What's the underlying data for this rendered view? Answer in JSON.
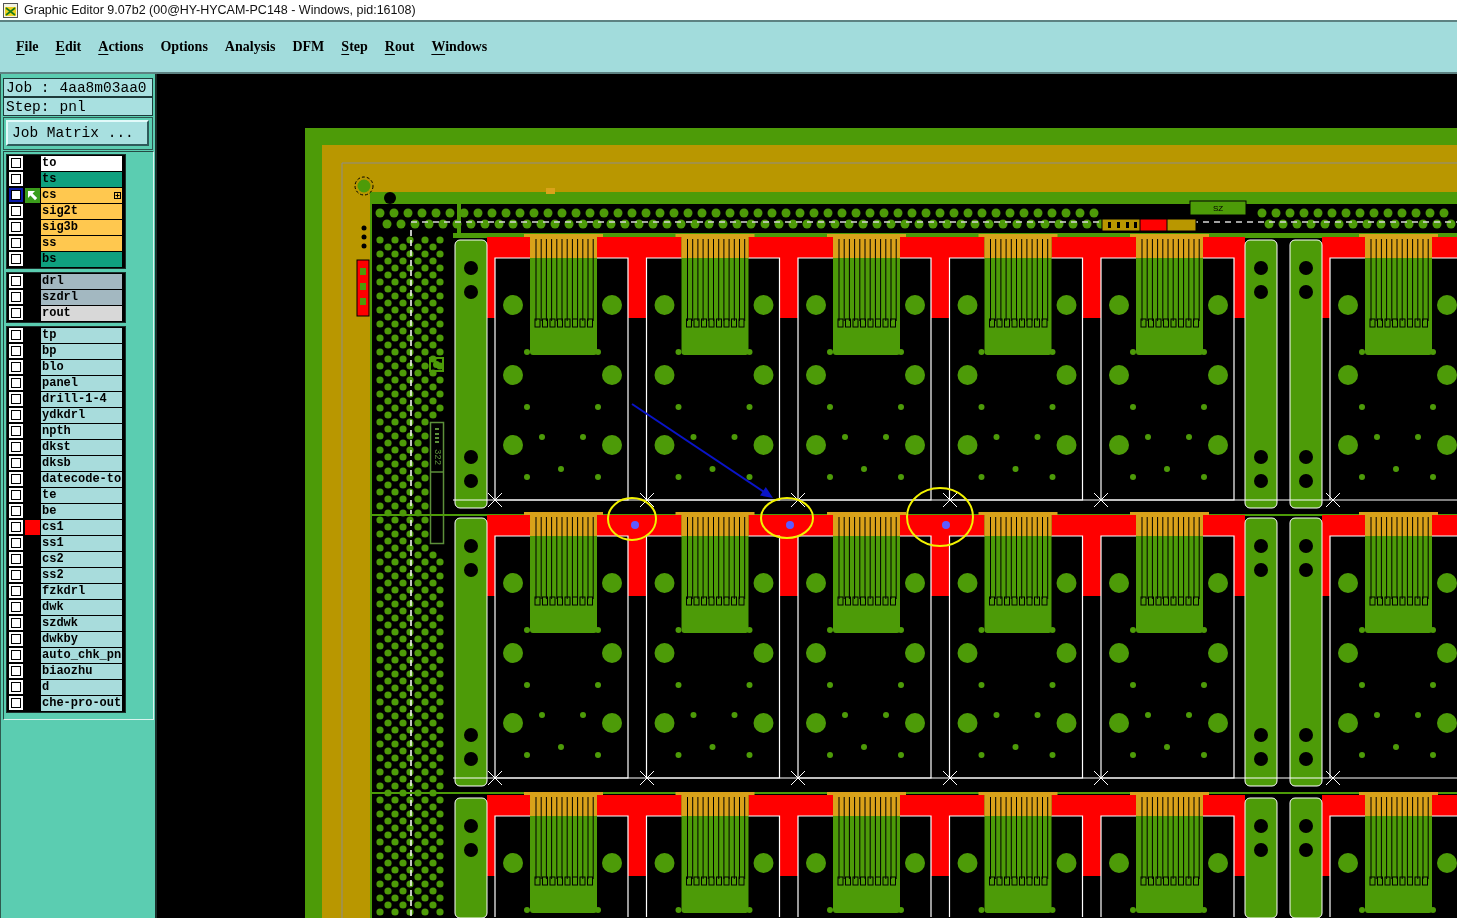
{
  "window": {
    "title": "Graphic Editor 9.07b2 (00@HY-HYCAM-PC148 - Windows, pid:16108)"
  },
  "menu": [
    {
      "label": "File",
      "mnemonic": true
    },
    {
      "label": "Edit",
      "mnemonic": true
    },
    {
      "label": "Actions",
      "mnemonic": true
    },
    {
      "label": "Options",
      "mnemonic": false
    },
    {
      "label": "Analysis",
      "mnemonic": false
    },
    {
      "label": "DFM",
      "mnemonic": false
    },
    {
      "label": "Step",
      "mnemonic": true
    },
    {
      "label": "Rout",
      "mnemonic": true
    },
    {
      "label": "Windows",
      "mnemonic": true
    }
  ],
  "job": {
    "label": "Job :",
    "value": "4aa8m03aa0"
  },
  "step": {
    "label": "Step:",
    "value": "pnl"
  },
  "job_matrix_button": "Job Matrix ...",
  "layer_groups": [
    {
      "layers": [
        {
          "name": "to",
          "color": "#ffffff",
          "checked": false,
          "selected": false,
          "displayed": false,
          "expandable": false
        },
        {
          "name": "ts",
          "color": "#0fa07f",
          "checked": false,
          "selected": false,
          "displayed": false,
          "expandable": false
        },
        {
          "name": "cs",
          "color": "#ffc84f",
          "checked": false,
          "selected": true,
          "displayed": false,
          "expandable": true
        },
        {
          "name": "sig2t",
          "color": "#ffc84f",
          "checked": false,
          "selected": false,
          "displayed": false,
          "expandable": false
        },
        {
          "name": "sig3b",
          "color": "#ffc84f",
          "checked": false,
          "selected": false,
          "displayed": false,
          "expandable": false
        },
        {
          "name": "ss",
          "color": "#ffc84f",
          "checked": false,
          "selected": false,
          "displayed": false,
          "expandable": false
        },
        {
          "name": "bs",
          "color": "#0fa07f",
          "checked": false,
          "selected": false,
          "displayed": false,
          "expandable": false
        }
      ]
    },
    {
      "layers": [
        {
          "name": "drl",
          "color": "#a3b8c1",
          "checked": false,
          "selected": false,
          "displayed": false,
          "expandable": false
        },
        {
          "name": "szdrl",
          "color": "#a3b8c1",
          "checked": false,
          "selected": false,
          "displayed": false,
          "expandable": false
        },
        {
          "name": "rout",
          "color": "#d8d8d8",
          "checked": false,
          "selected": false,
          "displayed": false,
          "expandable": false
        }
      ]
    },
    {
      "layers": [
        {
          "name": "tp",
          "color": "#a8dcdc",
          "checked": false,
          "selected": false,
          "displayed": false,
          "expandable": false
        },
        {
          "name": "bp",
          "color": "#a8dcdc",
          "checked": false,
          "selected": false,
          "displayed": false,
          "expandable": false
        },
        {
          "name": "blo",
          "color": "#a8dcdc",
          "checked": false,
          "selected": false,
          "displayed": false,
          "expandable": false
        },
        {
          "name": "panel",
          "color": "#a8dcdc",
          "checked": false,
          "selected": false,
          "displayed": false,
          "expandable": false
        },
        {
          "name": "drill-1-4",
          "color": "#a8dcdc",
          "checked": false,
          "selected": false,
          "displayed": false,
          "expandable": false
        },
        {
          "name": "ydkdrl",
          "color": "#a8dcdc",
          "checked": false,
          "selected": false,
          "displayed": false,
          "expandable": false
        },
        {
          "name": "npth",
          "color": "#a8dcdc",
          "checked": false,
          "selected": false,
          "displayed": false,
          "expandable": false
        },
        {
          "name": "dkst",
          "color": "#a8dcdc",
          "checked": false,
          "selected": false,
          "displayed": false,
          "expandable": false
        },
        {
          "name": "dksb",
          "color": "#a8dcdc",
          "checked": false,
          "selected": false,
          "displayed": false,
          "expandable": false
        },
        {
          "name": "datecode-to",
          "color": "#a8dcdc",
          "checked": false,
          "selected": false,
          "displayed": false,
          "expandable": false
        },
        {
          "name": "te",
          "color": "#a8dcdc",
          "checked": false,
          "selected": false,
          "displayed": false,
          "expandable": false
        },
        {
          "name": "be",
          "color": "#a8dcdc",
          "checked": false,
          "selected": false,
          "displayed": false,
          "expandable": false
        },
        {
          "name": "cs1",
          "color": "#a8dcdc",
          "checked": false,
          "selected": false,
          "displayed": true,
          "display": {
            "color": "#ff0000"
          },
          "expandable": false
        },
        {
          "name": "ss1",
          "color": "#a8dcdc",
          "checked": false,
          "selected": false,
          "displayed": false,
          "expandable": false
        },
        {
          "name": "cs2",
          "color": "#a8dcdc",
          "checked": false,
          "selected": false,
          "displayed": false,
          "expandable": false
        },
        {
          "name": "ss2",
          "color": "#a8dcdc",
          "checked": false,
          "selected": false,
          "displayed": false,
          "expandable": false
        },
        {
          "name": "fzkdrl",
          "color": "#a8dcdc",
          "checked": false,
          "selected": false,
          "displayed": false,
          "expandable": false
        },
        {
          "name": "dwk",
          "color": "#a8dcdc",
          "checked": false,
          "selected": false,
          "displayed": false,
          "expandable": false
        },
        {
          "name": "szdwk",
          "color": "#a8dcdc",
          "checked": false,
          "selected": false,
          "displayed": false,
          "expandable": false
        },
        {
          "name": "dwkby",
          "color": "#a8dcdc",
          "checked": false,
          "selected": false,
          "displayed": false,
          "expandable": false
        },
        {
          "name": "auto_chk_pn",
          "color": "#a8dcdc",
          "checked": false,
          "selected": false,
          "displayed": false,
          "expandable": false
        },
        {
          "name": "biaozhu",
          "color": "#a8dcdc",
          "checked": false,
          "selected": false,
          "displayed": false,
          "expandable": false
        },
        {
          "name": "d",
          "color": "#a8dcdc",
          "checked": false,
          "selected": false,
          "displayed": false,
          "expandable": false
        },
        {
          "name": "che-pro-out",
          "color": "#a8dcdc",
          "checked": false,
          "selected": false,
          "displayed": false,
          "expandable": false
        }
      ]
    }
  ],
  "canvas": {
    "board_label": "SZ",
    "vertical_label": "322"
  }
}
